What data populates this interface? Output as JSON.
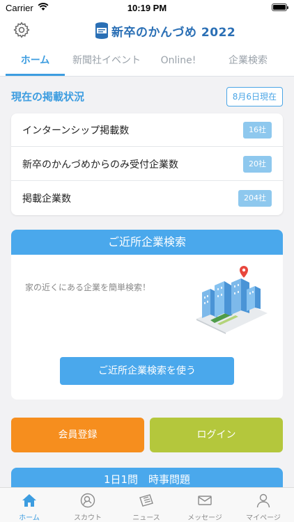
{
  "status_bar": {
    "carrier": "Carrier",
    "time": "10:19 PM"
  },
  "header": {
    "logo_text": "新卒のかんづめ 2022"
  },
  "tabs": [
    {
      "label": "ホーム",
      "active": true
    },
    {
      "label": "新聞社イベント",
      "active": false
    },
    {
      "label": "Online!",
      "active": false
    },
    {
      "label": "企業検索",
      "active": false
    }
  ],
  "status_section": {
    "title": "現在の掲載状況",
    "date_badge": "8月6日現在",
    "rows": [
      {
        "label": "インターンシップ掲載数",
        "count": "16社"
      },
      {
        "label": "新卒のかんづめからのみ受付企業数",
        "count": "20社"
      },
      {
        "label": "掲載企業数",
        "count": "204社"
      }
    ]
  },
  "nearby": {
    "heading": "ご近所企業検索",
    "description": "家の近くにある企業を簡単検索！",
    "button_label": "ご近所企業検索を使う"
  },
  "actions": {
    "register_label": "会員登録",
    "login_label": "ログイン"
  },
  "quiz": {
    "heading": "1日1問　時事問題"
  },
  "tabbar": [
    {
      "label": "ホーム",
      "icon": "home-icon",
      "active": true
    },
    {
      "label": "スカウト",
      "icon": "scout-icon",
      "active": false
    },
    {
      "label": "ニュース",
      "icon": "news-icon",
      "active": false
    },
    {
      "label": "メッセージ",
      "icon": "mail-icon",
      "active": false
    },
    {
      "label": "マイページ",
      "icon": "person-icon",
      "active": false
    }
  ],
  "colors": {
    "accent": "#3d9de0",
    "header_blue": "#4aa8ec",
    "register": "#f68e1e",
    "login": "#b4c73c",
    "badge": "#8ec8ee"
  }
}
